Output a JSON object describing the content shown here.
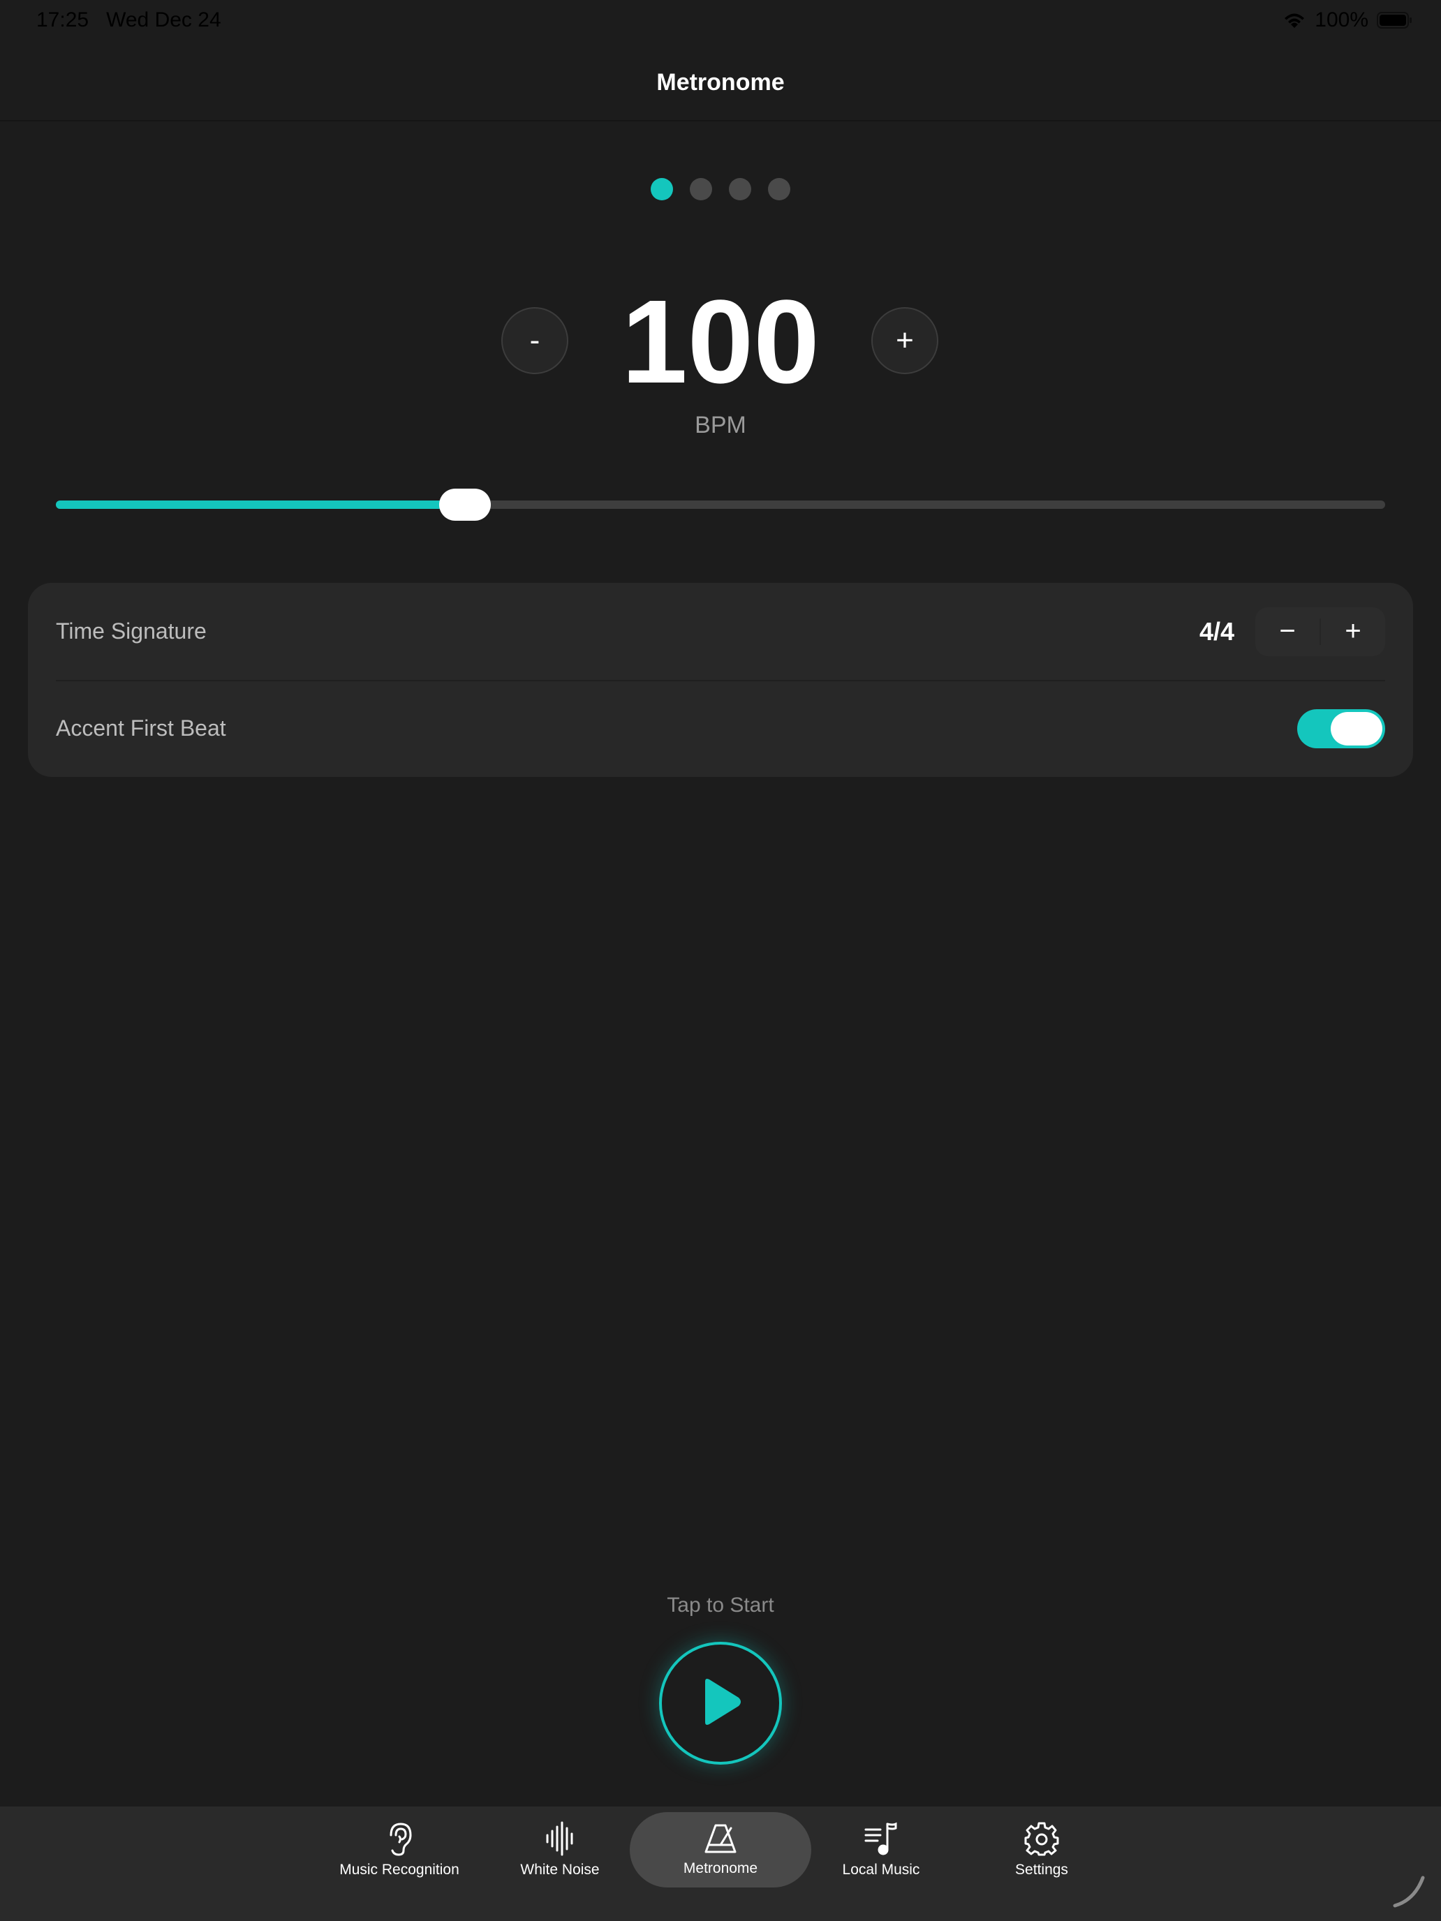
{
  "status_bar": {
    "time": "17:25",
    "date": "Wed Dec 24",
    "battery": "100%"
  },
  "header": {
    "title": "Metronome"
  },
  "beats": {
    "count": 4,
    "active_index": 0,
    "accent_color": "#14c6bd"
  },
  "tempo": {
    "bpm": "100",
    "unit": "BPM",
    "minus_label": "-",
    "plus_label": "+",
    "slider_fraction": 0.308
  },
  "settings": {
    "time_signature_label": "Time Signature",
    "time_signature_value": "4/4",
    "stepper_minus": "−",
    "stepper_plus": "+",
    "accent_label": "Accent First Beat",
    "accent_on": true
  },
  "player": {
    "prompt": "Tap to Start",
    "icon": "play-icon"
  },
  "tabs": [
    {
      "label": "Music Recognition",
      "icon": "ear-icon",
      "active": false
    },
    {
      "label": "White Noise",
      "icon": "waveform-icon",
      "active": false
    },
    {
      "label": "Metronome",
      "icon": "metronome-icon",
      "active": true
    },
    {
      "label": "Local Music",
      "icon": "music-list-icon",
      "active": false
    },
    {
      "label": "Settings",
      "icon": "gear-icon",
      "active": false
    }
  ]
}
